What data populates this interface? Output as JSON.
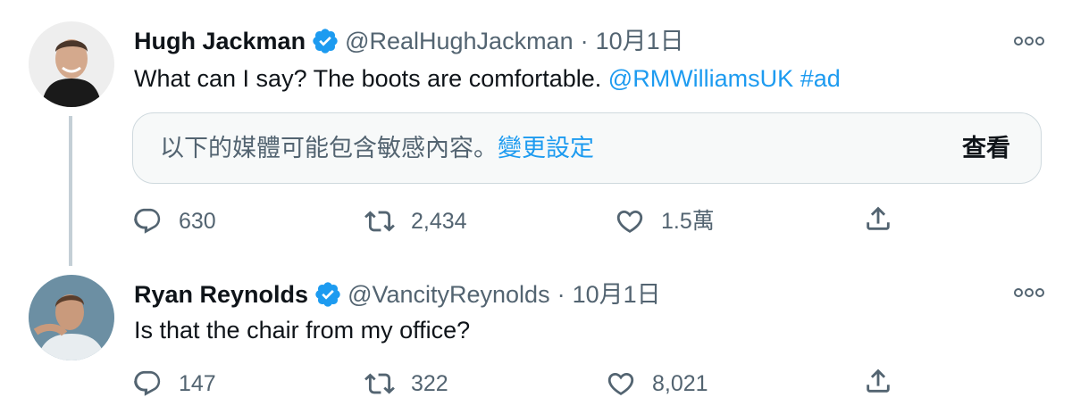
{
  "tweets": [
    {
      "name": "Hugh Jackman",
      "handle": "@RealHughJackman",
      "separator": "·",
      "date": "10月1日",
      "text": "What can I say? The boots are comfortable. ",
      "mention": "@RMWilliamsUK",
      "hashtag": "#ad",
      "sensitive_notice": "以下的媒體可能包含敏感內容。",
      "sensitive_link": "變更設定",
      "view_label": "查看",
      "replies": "630",
      "retweets": "2,434",
      "likes": "1.5萬"
    },
    {
      "name": "Ryan Reynolds",
      "handle": "@VancityReynolds",
      "separator": "·",
      "date": "10月1日",
      "text": "Is that the chair from my office?",
      "replies": "147",
      "retweets": "322",
      "likes": "8,021"
    }
  ],
  "colors": {
    "accent": "#1d9bf0",
    "secondary_text": "#536471",
    "primary_text": "#0f1419",
    "border": "#cfd9de",
    "thread_line": "#c4cfd6"
  },
  "icons": [
    "verified-badge-icon",
    "more-icon",
    "reply-icon",
    "retweet-icon",
    "like-icon",
    "share-icon"
  ]
}
